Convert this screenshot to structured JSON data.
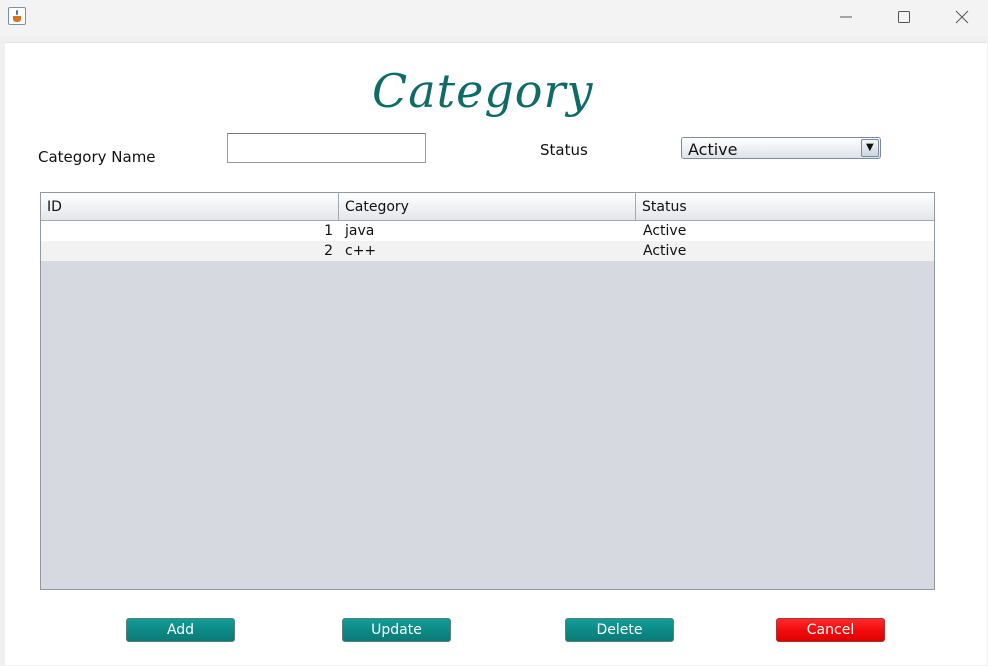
{
  "window": {
    "app_icon": "java-cup-icon",
    "controls": [
      "minimize-icon",
      "maximize-icon",
      "close-icon"
    ]
  },
  "form": {
    "title": "Category",
    "category_name_label": "Category Name",
    "category_name_value": "",
    "status_label": "Status",
    "status_selected": "Active"
  },
  "table": {
    "columns": [
      "ID",
      "Category",
      "Status"
    ],
    "rows": [
      {
        "id": "1",
        "category": "java",
        "status": "Active"
      },
      {
        "id": "2",
        "category": "c++",
        "status": "Active"
      }
    ]
  },
  "buttons": {
    "add": "Add",
    "update": "Update",
    "delete": "Delete",
    "cancel": "Cancel"
  },
  "colors": {
    "title": "#0e6b68",
    "action_button": "#0d8a86",
    "cancel_button": "#f20d0d",
    "table_empty_area": "#d6d9e0"
  }
}
